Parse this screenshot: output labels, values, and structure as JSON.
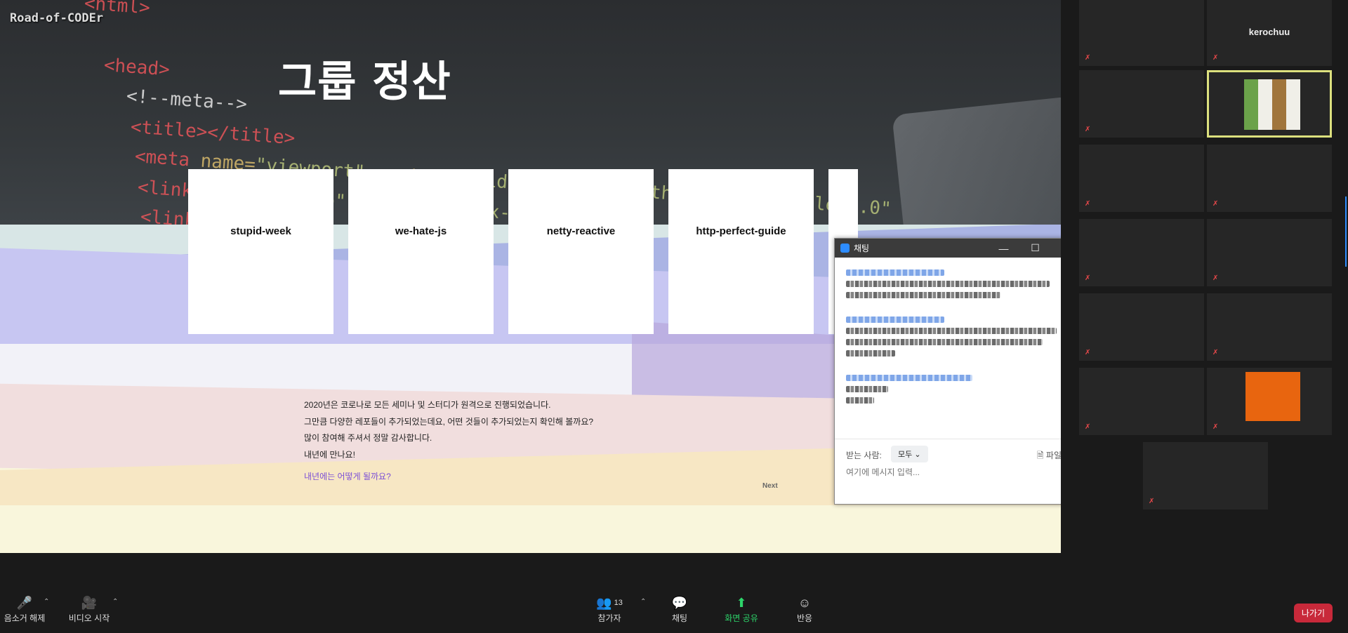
{
  "shared_screen": {
    "watermark": "Road-of-CODEr",
    "slide_title": "그룹 정산",
    "cards": [
      "stupid-week",
      "we-hate-js",
      "netty-reactive",
      "http-perfect-guide",
      ""
    ],
    "paragraph": [
      "2020년은 코로나로 모든 세미나 및 스터디가 원격으로 진행되었습니다.",
      "그만큼 다양한 레포들이 추가되었는데요, 어떤 것들이 추가되었는지 확인해 볼까요?",
      "많이 참여해 주셔서 정말 감사합니다.",
      "내년에 만나요!"
    ],
    "link_text": "내년에는 어떻게 될까요?",
    "next_button": "Next"
  },
  "chat": {
    "title": "채팅",
    "to_label": "받는 사람:",
    "to_value": "모두",
    "file_button": "파일",
    "input_placeholder": "여기에 메시지 입력..."
  },
  "participants": [
    {
      "name": ""
    },
    {
      "name": "kerochuu"
    },
    {
      "name": ""
    },
    {
      "name": ""
    },
    {
      "name": ""
    },
    {
      "name": ""
    },
    {
      "name": ""
    },
    {
      "name": ""
    },
    {
      "name": ""
    },
    {
      "name": ""
    },
    {
      "name": ""
    },
    {
      "name": ""
    },
    {
      "name": ""
    }
  ],
  "toolbar": {
    "unmute": "음소거 해제",
    "start_video": "비디오 시작",
    "participants": "참가자",
    "participants_count": "13",
    "chat": "채팅",
    "share_screen": "화면 공유",
    "reactions": "반응",
    "leave": "나가기"
  }
}
